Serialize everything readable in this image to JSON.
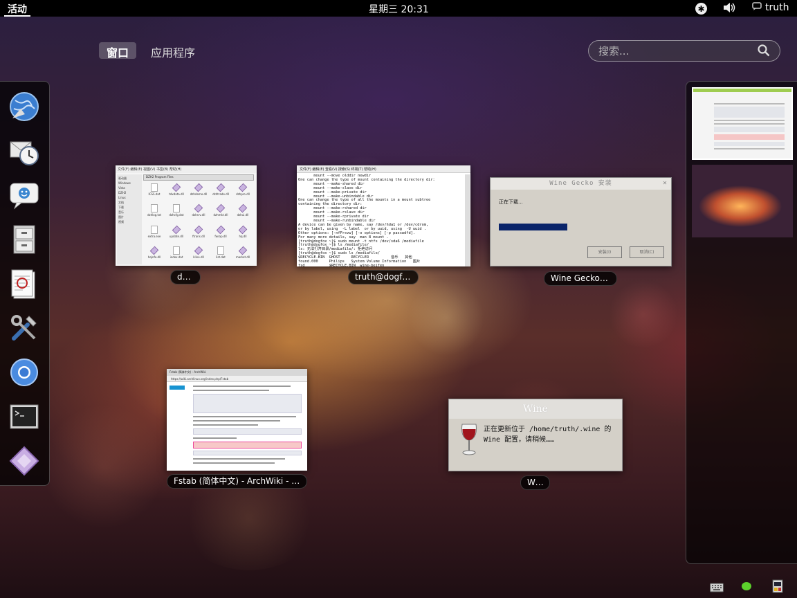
{
  "topbar": {
    "activities": "活动",
    "clock": "星期三 20:31",
    "user": "truth"
  },
  "view_tabs": {
    "windows": "窗口",
    "applications": "应用程序"
  },
  "search": {
    "placeholder": "搜索..."
  },
  "dash": {
    "items": [
      {
        "name": "browser-globe-icon"
      },
      {
        "name": "mail-clock-icon"
      },
      {
        "name": "chat-icon"
      },
      {
        "name": "file-cabinet-icon"
      },
      {
        "name": "document-editor-icon"
      },
      {
        "name": "settings-tools-icon"
      },
      {
        "name": "chromium-icon"
      },
      {
        "name": "terminal-icon"
      },
      {
        "name": "wine-diamond-icon"
      }
    ]
  },
  "windows": {
    "dzh2": {
      "caption": "dzh2",
      "menubar": "文件(F) 编辑(E) 视图(V) 书签(B) 帮助(H)",
      "path": "DZH2 Program Files",
      "sidebar": [
        "驱动器",
        "Windows",
        "Vista",
        "DZH2",
        "Linux",
        "文档",
        "下载",
        "音乐",
        "图片",
        "视频"
      ],
      "files": [
        "ICSS.dat",
        "tdxdata.dll",
        "dzhdemo.dll",
        "dzhtrade.dll",
        "dzhpro.dll",
        "dzhlog.txt",
        "dzhcfg.dat",
        "dzhsrv.dll",
        "dzhmkt.dll",
        "dzhui.dll",
        "extra.exe",
        "update.dll",
        "ftrans.dll",
        "fwrap.dll",
        "hq.dll",
        "hqinfo.dll",
        "index.dat",
        "kline.dll",
        "list.dat",
        "market.dll"
      ]
    },
    "terminal": {
      "caption": "truth@dogfox:~",
      "menubar": "文件(F)  编辑(E)  查看(V)  搜索(S)  终端(T)  帮助(H)",
      "lines": [
        "       mount --move olddir newdir",
        "One can change the type of mount containing the directory dir:",
        "       mount --make-shared dir",
        "       mount --make-slave dir",
        "       mount --make-private dir",
        "       mount --make-unbindable dir",
        "One can change the type of all the mounts in a mount subtree",
        "containing the directory dir:",
        "       mount --make-rshared dir",
        "       mount --make-rslave dir",
        "       mount --make-rprivate dir",
        "       mount --make-runbindable dir",
        "A device can be given by name, say /dev/hda1 or /dev/cdrom,",
        "or by label, using  -L label  or by uuid, using  -U uuid .",
        "Other options: [-nfFrsvw] [-o options] [-p passwdfd].",
        "For many more details, say  man 8 mount .",
        "[truth@dogfox ~]$ sudo mount -t ntfs /dev/sda6 /mediafile",
        "[truth@dogfox ~]$ ls /mediafile/",
        "ls: 无法打开目录/mediafile/: 拒绝访问",
        "[truth@dogfox ~]$ sudo ls /mediafile/",
        "$RECYCLE.BIN  GHOST     RECYCLER          音乐   其他",
        "found.000     Philips   System Volume Information   图片",
        "fsd           $RECYCLE.BIN  wine-beifen",
        "[truth@dogfox ~]$ ▌"
      ]
    },
    "gecko": {
      "caption": "Wine Gecko 安装",
      "title": "Wine Gecko 安装",
      "message": "正在下载...",
      "progress": 0.62,
      "btn_install": "安装(I)",
      "btn_cancel": "取消(C)"
    },
    "wiki": {
      "caption": "Fstab (简体中文) - ArchWiki - Chromium",
      "tab": "Fstab (简体中文) - ArchWiki",
      "url": "https://wiki.archlinux.org/index.php/Fstab"
    },
    "wine": {
      "caption": "Wine",
      "title": "Wine",
      "message": "正在更新位于 /home/truth/.wine 的 Wine 配置，请稍候……"
    }
  },
  "colors": {
    "topbar": "#000000",
    "progress": "#0a246a",
    "tray_green": "#5cd02c"
  }
}
